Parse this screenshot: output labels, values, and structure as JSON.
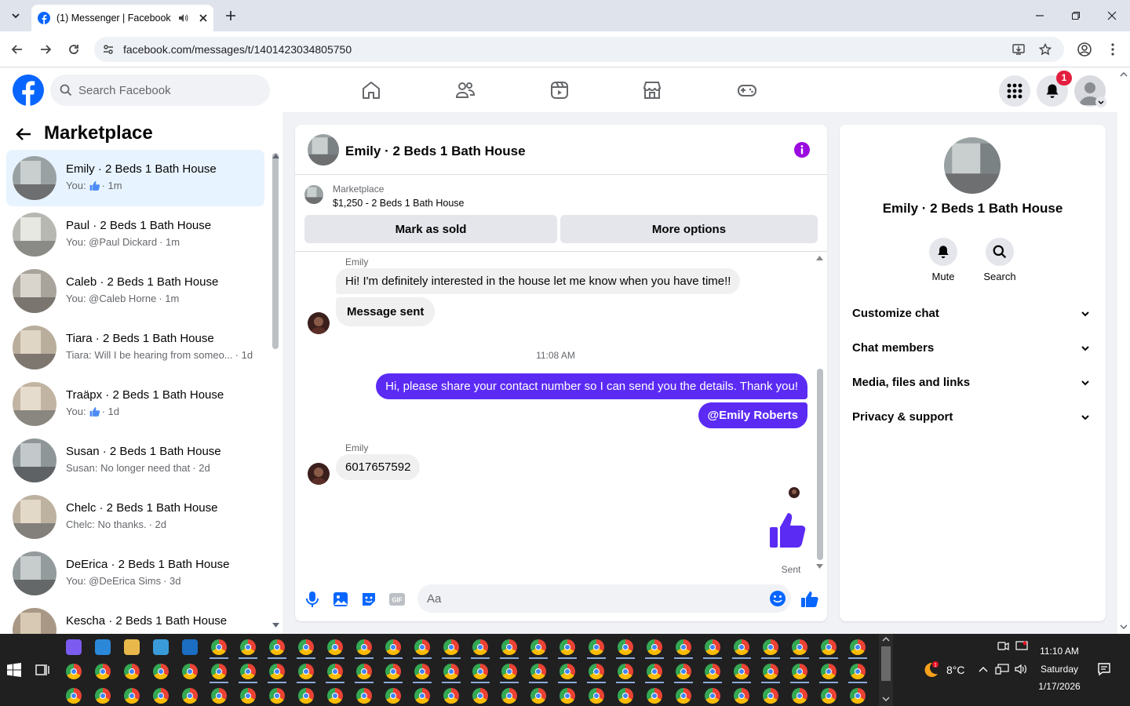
{
  "browser": {
    "tab_title": "(1) Messenger | Facebook",
    "url": "facebook.com/messages/t/1401423034805750"
  },
  "fb": {
    "search_placeholder": "Search Facebook",
    "notifications_count": "1",
    "brand_color": "#0866ff"
  },
  "sidebar": {
    "title": "Marketplace",
    "conversations": [
      {
        "name": "Emily · 2 Beds 1 Bath House",
        "preview": "You:",
        "preview_icon": "like-icon",
        "time": "· 1m",
        "active": true
      },
      {
        "name": "Paul · 2 Beds 1 Bath House",
        "preview": "You: @Paul Dickard",
        "time": "· 1m"
      },
      {
        "name": "Caleb · 2 Beds 1 Bath House",
        "preview": "You: @Caleb Horne",
        "time": "· 1m"
      },
      {
        "name": "Tiara · 2 Beds 1 Bath House",
        "preview": "Tiara: Will I be hearing from someo...",
        "time": "· 1d"
      },
      {
        "name": "Traäpx · 2 Beds 1 Bath House",
        "preview": "You:",
        "preview_icon": "like-icon",
        "time": "· 1d"
      },
      {
        "name": "Susan · 2 Beds 1 Bath House",
        "preview": "Susan: No longer need that",
        "time": "· 2d"
      },
      {
        "name": "Chelc · 2 Beds 1 Bath House",
        "preview": "Chelc: No thanks.",
        "time": "· 2d"
      },
      {
        "name": "DeErica · 2 Beds 1 Bath House",
        "preview": "You: @DeErica Sims",
        "time": "· 3d"
      },
      {
        "name": "Kescha · 2 Beds 1 Bath House",
        "preview": "",
        "time": ""
      }
    ]
  },
  "chat": {
    "title": "Emily · 2 Beds 1 Bath House",
    "listing_label": "Marketplace",
    "listing_desc": "$1,250 - 2 Beds 1 Bath House",
    "mark_sold": "Mark as sold",
    "more_options": "More options",
    "messages": {
      "sender1": "Emily",
      "msg1": "Hi! I'm definitely interested in the house let me know when you have time!!",
      "msg2": "Message sent",
      "timestamp": "11:08 AM",
      "msg3": "Hi, please share your contact number so I can send you the details. Thank you!",
      "msg4": "@Emily Roberts",
      "sender2": "Emily",
      "msg5": "6017657592",
      "status": "Sent"
    },
    "composer_placeholder": "Aa",
    "accent_color": "#5b2bf4"
  },
  "panel": {
    "name": "Emily · 2 Beds 1 Bath House",
    "mute": "Mute",
    "search": "Search",
    "sections": [
      "Customize chat",
      "Chat members",
      "Media, files and links",
      "Privacy & support"
    ]
  },
  "taskbar": {
    "weather": "8°C",
    "time": "11:10 AM",
    "day": "Saturday",
    "date": "1/17/2026"
  }
}
